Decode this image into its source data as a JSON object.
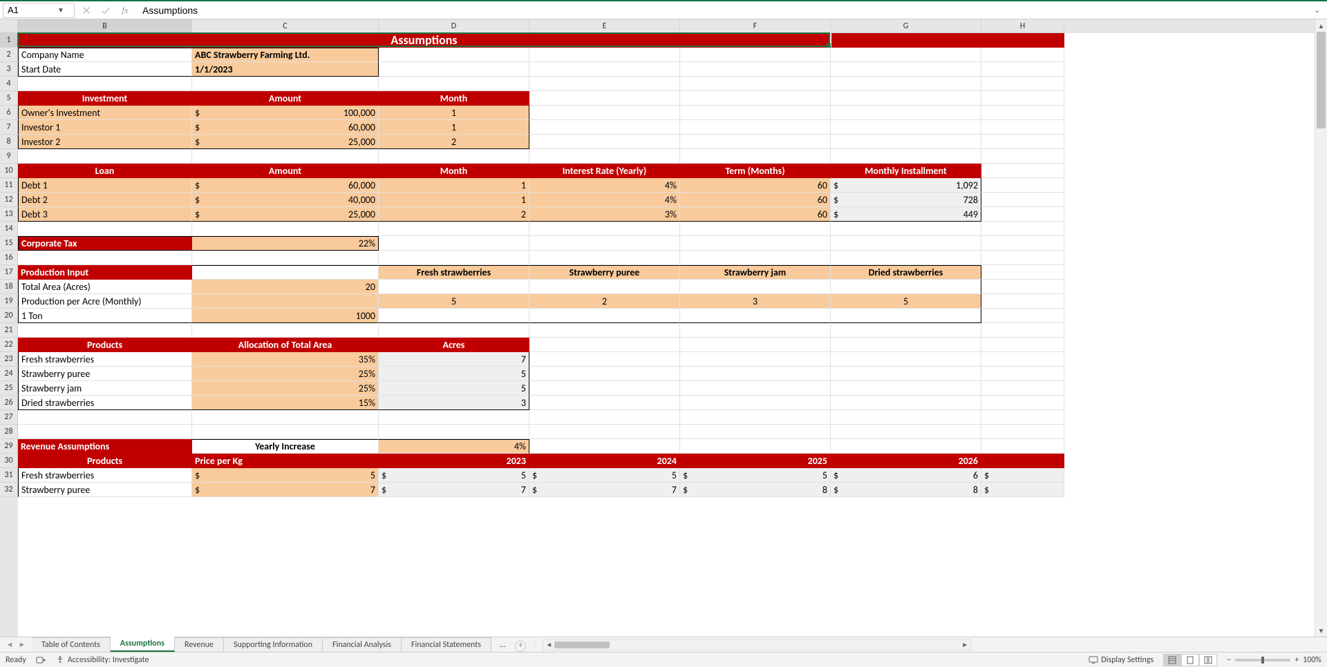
{
  "nameBox": "A1",
  "formulaBarValue": "Assumptions",
  "columns": [
    "B",
    "C",
    "D",
    "E",
    "F",
    "G",
    "H"
  ],
  "rowCount": 32,
  "title": "Assumptions",
  "companyInfo": {
    "r2": {
      "label": "Company Name",
      "value": "ABC Strawberry Farming Ltd."
    },
    "r3": {
      "label": "Start Date",
      "value": "1/1/2023"
    }
  },
  "investmentHeader": [
    "Investment",
    "Amount",
    "Month"
  ],
  "investments": [
    {
      "name": "Owner's Investment",
      "sym": "$",
      "amount": "100,000",
      "month": "1"
    },
    {
      "name": "Investor 1",
      "sym": "$",
      "amount": "60,000",
      "month": "1"
    },
    {
      "name": "Investor 2",
      "sym": "$",
      "amount": "25,000",
      "month": "2"
    }
  ],
  "loanHeader": [
    "Loan",
    "Amount",
    "Month",
    "Interest Rate (Yearly)",
    "Term (Months)",
    "Monthly Installment"
  ],
  "loans": [
    {
      "name": "Debt 1",
      "sym": "$",
      "amount": "60,000",
      "month": "1",
      "rate": "4%",
      "term": "60",
      "inst_sym": "$",
      "inst": "1,092"
    },
    {
      "name": "Debt 2",
      "sym": "$",
      "amount": "40,000",
      "month": "1",
      "rate": "4%",
      "term": "60",
      "inst_sym": "$",
      "inst": "728"
    },
    {
      "name": "Debt 3",
      "sym": "$",
      "amount": "25,000",
      "month": "2",
      "rate": "3%",
      "term": "60",
      "inst_sym": "$",
      "inst": "449"
    }
  ],
  "corporateTax": {
    "label": "Corporate Tax",
    "value": "22%"
  },
  "productionInput": {
    "label": "Production Input",
    "colHeaders": [
      "",
      "Fresh strawberries",
      "Strawberry puree",
      "Strawberry jam",
      "Dried strawberries"
    ],
    "rows": [
      {
        "label": "Total Area (Acres)",
        "c": "20",
        "d": "",
        "e": "",
        "f": "",
        "g": ""
      },
      {
        "label": "Production per Acre (Monthly)",
        "c": "",
        "d": "5",
        "e": "2",
        "f": "3",
        "g": "5"
      },
      {
        "label": "1 Ton",
        "c": "1000",
        "d": "",
        "e": "",
        "f": "",
        "g": ""
      }
    ]
  },
  "productsAlloc": {
    "header": [
      "Products",
      "Allocation of Total Area",
      "Acres"
    ],
    "rows": [
      {
        "name": "Fresh strawberries",
        "alloc": "35%",
        "acres": "7"
      },
      {
        "name": "Strawberry puree",
        "alloc": "25%",
        "acres": "5"
      },
      {
        "name": "Strawberry jam",
        "alloc": "25%",
        "acres": "5"
      },
      {
        "name": "Dried strawberries",
        "alloc": "15%",
        "acres": "3"
      }
    ]
  },
  "revenueAssumptions": {
    "label": "Revenue Assumptions",
    "yearlyIncreaseLabel": "Yearly Increase",
    "yearlyIncrease": "4%",
    "header": [
      "Products",
      "Price per Kg",
      "2023",
      "2024",
      "2025",
      "2026"
    ],
    "rows": [
      {
        "name": "Fresh strawberries",
        "sym": "$",
        "price": "5",
        "y23s": "$",
        "y23": "5",
        "y24s": "$",
        "y24": "5",
        "y25s": "$",
        "y25": "5",
        "y26s": "$",
        "y26": "6",
        "trail": "$"
      },
      {
        "name": "Strawberry puree",
        "sym": "$",
        "price": "7",
        "y23s": "$",
        "y23": "7",
        "y24s": "$",
        "y24": "7",
        "y25s": "$",
        "y25": "8",
        "y26s": "$",
        "y26": "8",
        "trail": "$"
      }
    ]
  },
  "sheetTabs": [
    "Table of Contents",
    "Assumptions",
    "Revenue",
    "Supporting Information",
    "Financial Analysis",
    "Financial Statements"
  ],
  "activeTab": 1,
  "moreTabs": "…",
  "statusBar": {
    "ready": "Ready",
    "accessibility": "Accessibility: Investigate",
    "displaySettings": "Display Settings",
    "zoom": "100%"
  }
}
